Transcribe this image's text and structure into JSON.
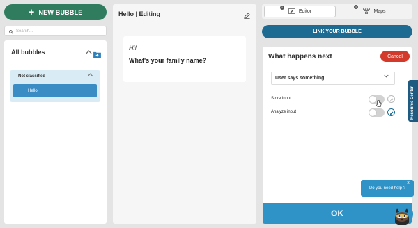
{
  "left": {
    "new_bubble_label": "NEW BUBBLE",
    "search_placeholder": "Search...",
    "all_bubbles": "All bubbles",
    "group": {
      "label": "Not classified",
      "items": [
        "Hello"
      ]
    }
  },
  "middle": {
    "title": "Hello  | Editing",
    "message_greeting": "Hi!",
    "message_question": "What's your family name?"
  },
  "right": {
    "tabs": [
      {
        "label": "Editor",
        "badge": "i",
        "active": true
      },
      {
        "label": "Maps",
        "badge": "i",
        "active": false
      }
    ],
    "link_bubble_label": "LINK YOUR BUBBLE",
    "section_title": "What happens next",
    "cancel_label": "Cancel",
    "select_value": "User says something",
    "options": [
      {
        "label": "Store input",
        "enabled": false
      },
      {
        "label": "Analyze input",
        "enabled": false
      }
    ],
    "ok_label": "OK"
  },
  "help": {
    "text": "Do you need help ?",
    "close": "×"
  },
  "resource_center_label": "Resource Center",
  "colors": {
    "new_bubble": "#2f7d5e",
    "link_bubble": "#1d6b93",
    "cancel": "#d33a2c",
    "ok": "#2f93c8",
    "selected_item": "#3a8cc4",
    "resource_tab": "#1f5a80"
  }
}
